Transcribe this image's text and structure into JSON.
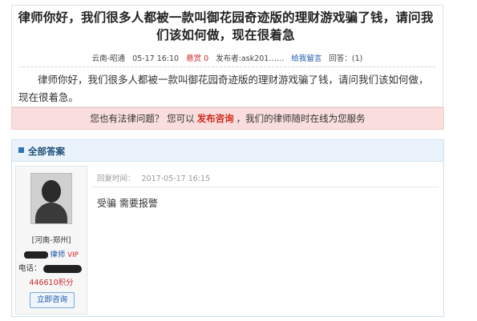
{
  "question": {
    "title": "律师你好，我们很多人都被一款叫御花园奇迹版的理财游戏骗了钱，请问我们该如何做，现在很着急",
    "meta": {
      "location": "云南-昭通",
      "date": "05-17 16:10",
      "reward": "悬赏 0",
      "asker": "发布者:ask201……",
      "leave_msg": "给我留言",
      "answers": "回答：(1)"
    },
    "body": "律师你好，我们很多人都被一款叫御花园奇迹版的理财游戏骗了钱，请问我们该如何做，现在很着急。"
  },
  "notice": {
    "prefix": "您也有法律问题？ 您可以",
    "link": "发布咨询",
    "suffix": "，我们的律师随时在线为您服务"
  },
  "answers_panel": {
    "title": "全部答案",
    "lawyer": {
      "location": "[河南-郑州]",
      "title": "律师",
      "vip": "VIP",
      "phone_label": "电话：",
      "points": "446610积分",
      "consult_button": "立即咨询"
    },
    "reply": {
      "time_label": "回复时间：",
      "time": "2017-05-17 16:15",
      "text": "受骗  需要报警"
    }
  }
}
